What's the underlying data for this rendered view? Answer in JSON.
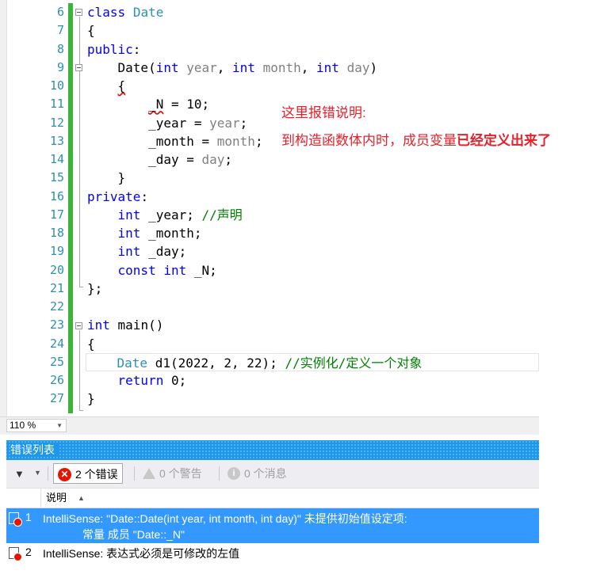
{
  "editor": {
    "line_numbers": [
      "6",
      "7",
      "8",
      "9",
      "10",
      "11",
      "12",
      "13",
      "14",
      "15",
      "16",
      "17",
      "18",
      "19",
      "20",
      "21",
      "22",
      "23",
      "24",
      "25",
      "26",
      "27"
    ],
    "notes": {
      "line1": "这里报错说明:",
      "line2_prefix": "到构造函数体内时，成员变量",
      "line2_bold": "已经定义出来了"
    }
  },
  "zoom": {
    "value": "110 %"
  },
  "error_list": {
    "title": "错误列表",
    "errors_button": "2 个错误",
    "warnings_button": "0 个警告",
    "messages_button": "0 个消息",
    "column_description": "说明",
    "rows": [
      {
        "num": "1",
        "text": "IntelliSense:  \"Date::Date(int year, int month, int day)\" 未提供初始值设定项:",
        "text2": "常量 成员 \"Date::_N\""
      },
      {
        "num": "2",
        "text": "IntelliSense:  表达式必须是可修改的左值"
      }
    ]
  },
  "colors": {
    "keyword": "#0000ff",
    "class_name": "#2b91af",
    "parameter": "#808080",
    "comment": "#008000",
    "note_red": "#e8202a",
    "change_bar": "#3cb43c",
    "selection": "#3399ff",
    "error_icon": "#e51400"
  }
}
